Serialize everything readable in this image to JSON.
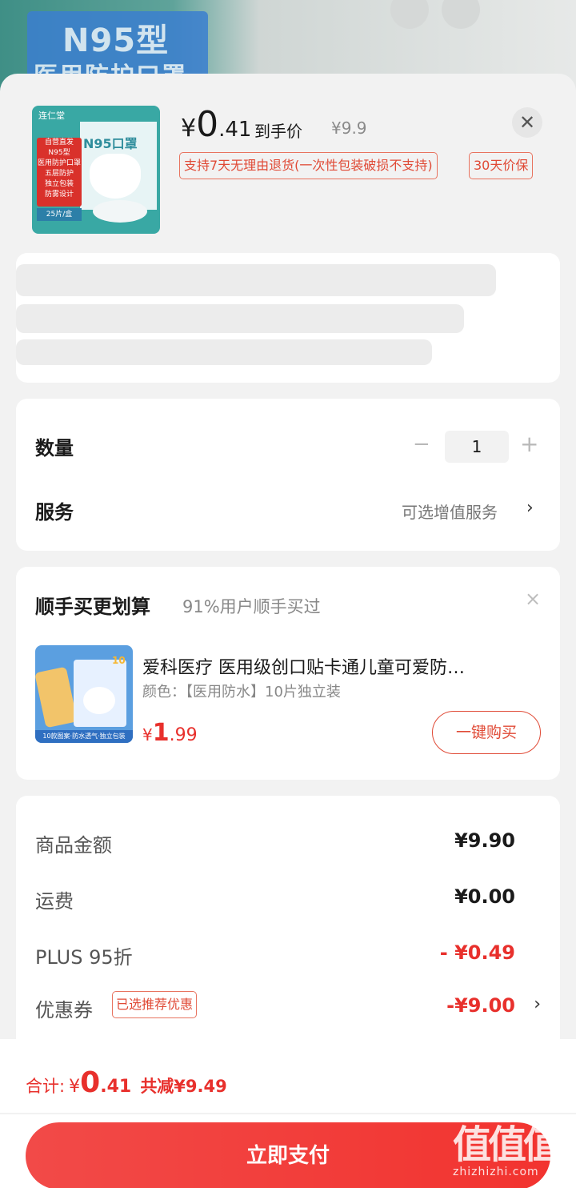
{
  "background": {
    "banner_line1": "N95型",
    "banner_line2": "医用防护口罩"
  },
  "product": {
    "thumb_brand": "连仁堂",
    "thumb_badge_lines": [
      "自营直发",
      "N95型",
      "医用防护口罩",
      "五层防护",
      "独立包装",
      "防雾设计"
    ],
    "thumb_count": "25片/盒",
    "thumb_box_text": "N95口罩",
    "price_yen": "¥",
    "price_int": "0",
    "price_dec": ".41",
    "price_label": "到手价",
    "price_original": "¥9.9",
    "tag_return": "支持7天无理由退货(一次性包装破损不支持)",
    "tag_protect": "30天价保"
  },
  "quantity": {
    "label": "数量",
    "minus": "−",
    "value": "1",
    "plus": "+"
  },
  "service": {
    "label": "服务",
    "value": "可选增值服务",
    "chevron": "›"
  },
  "bundle": {
    "title": "顺手买更划算",
    "subtitle": "91%用户顺手买过",
    "close": "×",
    "item_name": "爱科医疗 医用级创口贴卡通儿童可爱防…",
    "item_spec": "颜色：【医用防水】10片独立装",
    "item_price_yen": "¥",
    "item_price_int": "1",
    "item_price_dec": ".99",
    "item_thumb_tag": "10",
    "item_thumb_foot": "10款图案·防水透气·独立包装",
    "buy_label": "一键购买"
  },
  "summary": {
    "rows": [
      {
        "label": "商品金额",
        "value": "¥9.90"
      },
      {
        "label": "运费",
        "value": "¥0.00"
      },
      {
        "label": "PLUS 95折",
        "value": "- ¥0.49"
      },
      {
        "label": "优惠券",
        "badge": "已选推荐优惠",
        "value": "-¥9.00",
        "chevron": "›"
      }
    ]
  },
  "footer": {
    "total_label": "合计:",
    "total_yen": "¥",
    "total_int": "0",
    "total_dec": ".41",
    "saved": "共减¥9.49",
    "pay_label": "立即支付"
  },
  "watermark": {
    "chars": "值值值",
    "url": "zhizhizhi.com"
  },
  "colors": {
    "accent": "#e8302c",
    "pay_button": "#f2332f"
  }
}
